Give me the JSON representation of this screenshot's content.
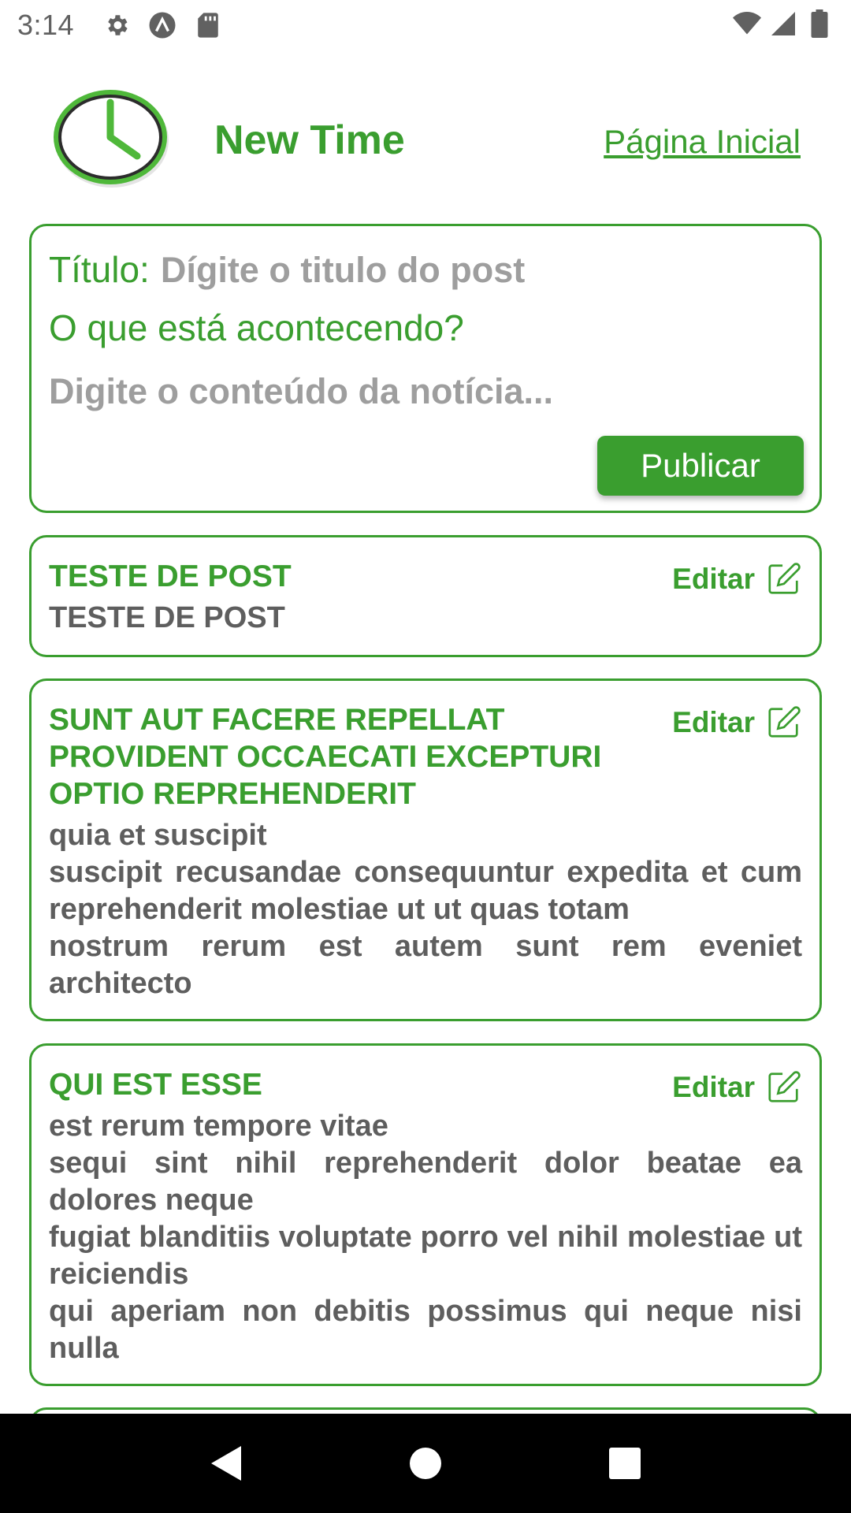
{
  "status_bar": {
    "time": "3:14",
    "left_icons": [
      "gear-icon",
      "a-icon",
      "sd-card-icon"
    ],
    "right_icons": [
      "wifi-icon",
      "signal-icon",
      "battery-icon"
    ]
  },
  "header": {
    "logo_icon": "clock-icon",
    "title": "New Time",
    "home_link": "Página Inicial"
  },
  "composer": {
    "title_label": "Título:",
    "title_placeholder": "Dígite o titulo do post",
    "question": "O que está acontecendo?",
    "content_placeholder": "Digite o conteúdo da notícia...",
    "publish_label": "Publicar"
  },
  "posts": [
    {
      "title": "TESTE DE POST",
      "body": "TESTE DE POST",
      "edit_label": "Editar"
    },
    {
      "title": "SUNT AUT FACERE REPELLAT PROVIDENT OCCAECATI EXCEPTURI OPTIO REPREHENDERIT",
      "body": "quia et suscipit\nsuscipit recusandae consequuntur expedita et cum reprehenderit molestiae ut ut quas totam\nnostrum rerum est autem sunt rem eveniet architecto",
      "edit_label": "Editar"
    },
    {
      "title": "QUI EST ESSE",
      "body": "est rerum tempore vitae\nsequi sint nihil reprehenderit dolor beatae ea dolores neque\nfugiat blanditiis voluptate porro vel nihil molestiae ut reiciendis\nqui aperiam non debitis possimus qui neque nisi nulla",
      "edit_label": "Editar"
    }
  ],
  "nav_bar": {
    "icons": [
      "back-icon",
      "home-icon",
      "recents-icon"
    ]
  },
  "colors": {
    "accent": "#3a9e2f",
    "body_text": "#5e5e5e",
    "placeholder": "#9e9e9e"
  }
}
